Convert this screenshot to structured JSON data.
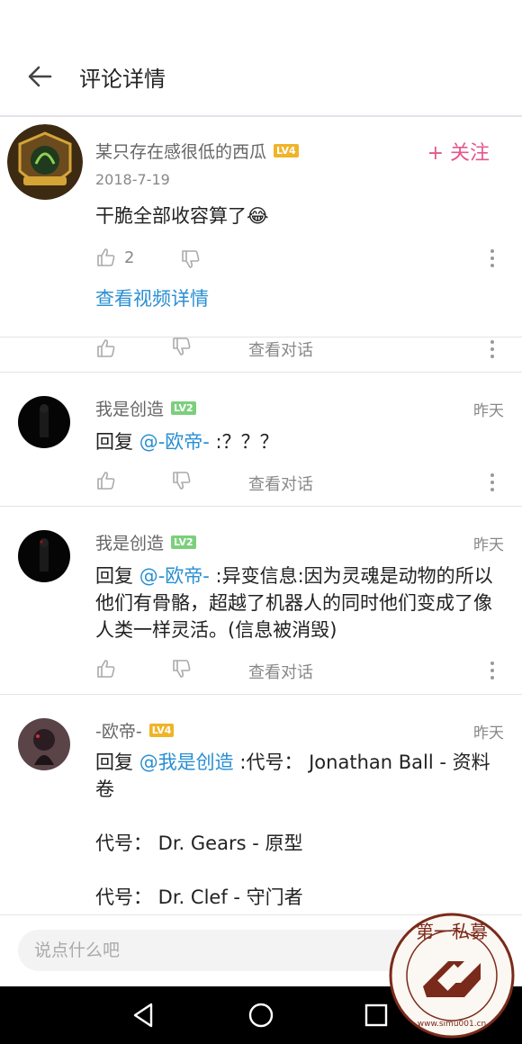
{
  "header": {
    "title": "评论详情"
  },
  "main_comment": {
    "author": "某只存在感很低的西瓜",
    "level": "LV4",
    "date": "2018-7-19",
    "follow_label": "+ 关注",
    "text": "干脆全部收容算了",
    "emoji": "😂",
    "like_count": "2",
    "view_video_label": "查看视频详情"
  },
  "partial_row": {
    "view_conversation": "查看对话"
  },
  "replies": [
    {
      "author": "我是创造",
      "level": "LV2",
      "time": "昨天",
      "prefix": "回复 ",
      "mention": "@-欧帝-",
      "body": " :？？？",
      "view_conversation": "查看对话"
    },
    {
      "author": "我是创造",
      "level": "LV2",
      "time": "昨天",
      "prefix": "回复 ",
      "mention": "@-欧帝-",
      "body": " :异变信息:因为灵魂是动物的所以他们有骨骼，超越了机器人的同时他们变成了像人类一样灵活。(信息被消毁)",
      "view_conversation": "查看对话"
    },
    {
      "author": "-欧帝-",
      "level": "LV4",
      "time": "昨天",
      "prefix": "回复 ",
      "mention": "@我是创造",
      "body": " :代号： Jonathan Ball - 资料卷",
      "line2": "代号： Dr. Gears - 原型",
      "line3": "代号： Dr. Clef - 守门者"
    }
  ],
  "compose": {
    "placeholder": "说点什么吧"
  },
  "watermark": {
    "text": "第一私募",
    "url_text": "www.simu001.cn"
  },
  "colors": {
    "accent_pink": "#e4578b",
    "link_blue": "#2a8fd2",
    "lv4": "#f0b429",
    "lv2": "#7ccf7c"
  }
}
